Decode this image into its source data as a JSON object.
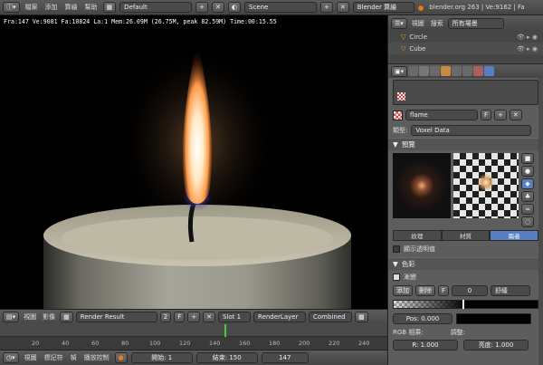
{
  "topbar": {
    "menus": [
      "檔案",
      "添加",
      "算繪",
      "幫助"
    ],
    "screen": "Default",
    "scene": "Scene",
    "engine": "Blender 算繪",
    "stats": "blender.org 263 | Ve:9162 | Fa"
  },
  "viewport": {
    "hud": "Fra:147  Ve:9081 Fa:10824 La:1 Mem:26.09M (26.75M, peak 82.59M) Time:00:15.55"
  },
  "image_editor": {
    "view": "視圖",
    "image": "影像",
    "image_name": "Render Result",
    "users": "2",
    "fake": "F",
    "slot": "Slot 1",
    "layer": "RenderLayer",
    "pass": "Combined"
  },
  "timeline": {
    "ticks": [
      "20",
      "40",
      "60",
      "80",
      "100",
      "120",
      "140",
      "160",
      "180",
      "200",
      "220",
      "240"
    ],
    "current_frame": 147
  },
  "bottombar": {
    "view": "視圖",
    "marker": "標記符",
    "frame": "幀",
    "playback": "播放控制",
    "start": "開始: 1",
    "end": "結束: 150",
    "current": "147"
  },
  "outliner": {
    "view": "視圖",
    "search": "搜索",
    "filter": "所有場景",
    "items": [
      "Circle",
      "Cube"
    ]
  },
  "properties": {
    "texture_name": "flame",
    "texture_fake": "F",
    "type_label": "類型:",
    "type_value": "Voxel Data",
    "preview_title": "預覽",
    "tabs": [
      "紋理",
      "材質",
      "兩者"
    ],
    "show_alpha": "顯示透明值",
    "colors_title": "色彩",
    "ramp_label": "漸變",
    "add_label": "添加",
    "delete_label": "刪除",
    "flip": "F",
    "stop_index": "0",
    "interp": "舒緩",
    "pos_label": "Pos: 0.000",
    "rgb_mult": "RGB 相乘:",
    "adjust": "調整:",
    "r_label": "R: 1.000",
    "brightness": "亮度: 1.000"
  },
  "colors": {
    "accent": "#5680c2",
    "panel": "#5d5d5d",
    "viewport_bg": "#000000",
    "frame_marker": "#44cc44"
  }
}
